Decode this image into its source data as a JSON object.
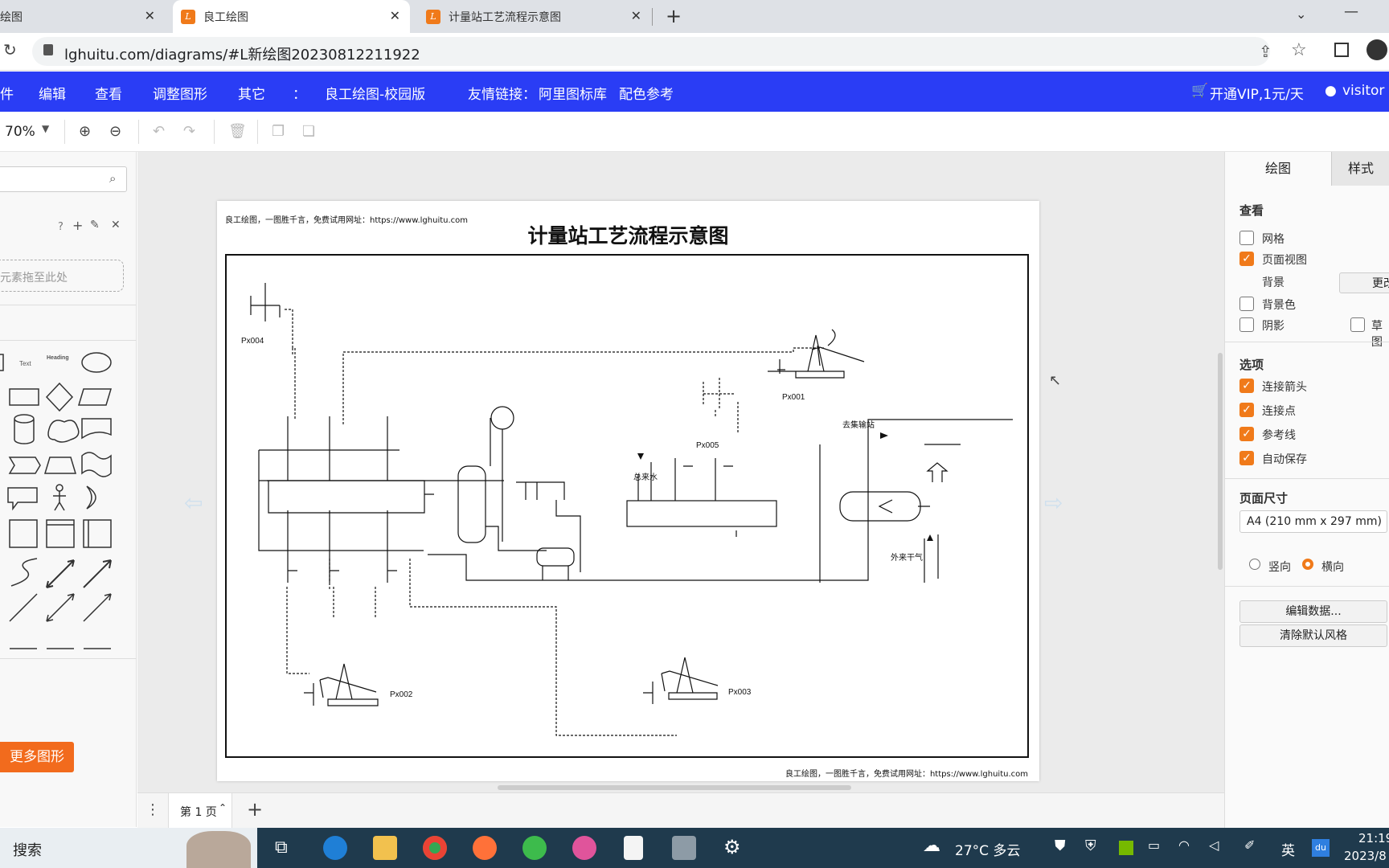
{
  "browser": {
    "tabs": [
      {
        "label": "绘图"
      },
      {
        "label": "良工绘图"
      },
      {
        "label": "计量站工艺流程示意图"
      }
    ],
    "new_tab": "+",
    "url": "lghuitu.com/diagrams/#L新绘图20230812211922"
  },
  "menu": {
    "items": [
      "件",
      "编辑",
      "查看",
      "调整图形",
      "其它",
      "：",
      "良工绘图-校园版",
      "友情链接：",
      "阿里图标库",
      "配色参考"
    ],
    "vip": "开通VIP,1元/天",
    "user": "visitor"
  },
  "toolbar": {
    "zoom": "70%"
  },
  "left": {
    "drop_hint": "元素拖至此处",
    "panel_icons": "?",
    "more_shapes": "更多图形",
    "text_shape": "Text",
    "heading_shape": "Heading"
  },
  "diagram": {
    "watermark_top": "良工绘图，一图胜千言，免费试用网址：https://www.lghuitu.com",
    "title": "计量站工艺流程示意图",
    "labels": {
      "px001": "Px001",
      "px002": "Px002",
      "px003": "Px003",
      "px004": "Px004",
      "px005": "Px005",
      "to_transfer": "去集输站",
      "water": "总来水",
      "gas": "外来干气"
    },
    "watermark_bottom": "良工绘图，一图胜千言，免费试用网址：https://www.lghuitu.com"
  },
  "right": {
    "tab_draw": "绘图",
    "tab_style": "样式",
    "view_heading": "查看",
    "grid": "网格",
    "page_view": "页面视图",
    "background": "背景",
    "change": "更改",
    "bgcolor": "背景色",
    "shadow": "阴影",
    "sketch": "草图",
    "options_heading": "选项",
    "conn_arrows": "连接箭头",
    "conn_points": "连接点",
    "guides": "参考线",
    "autosave": "自动保存",
    "page_size_heading": "页面尺寸",
    "page_size": "A4 (210 mm x 297 mm)",
    "portrait": "竖向",
    "landscape": "横向",
    "edit_data": "编辑数据...",
    "clear_style": "清除默认风格"
  },
  "pagebar": {
    "page": "第 1 页"
  },
  "taskbar": {
    "search": "搜索",
    "weather": "27°C  多云",
    "ime": "英",
    "time": "21:19",
    "date": "2023/8"
  }
}
